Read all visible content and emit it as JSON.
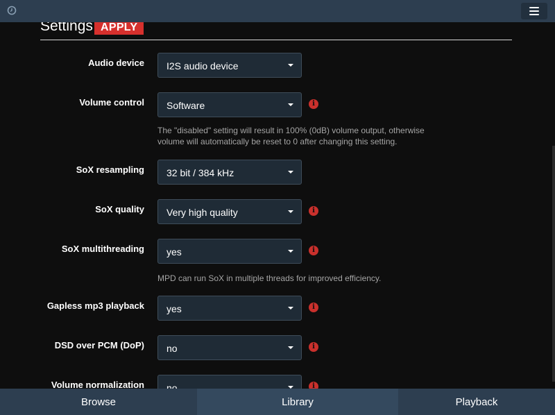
{
  "app": {
    "icons": {
      "status": "clock-icon",
      "menu": "hamburger-menu-icon",
      "info": "info-circle-icon"
    },
    "colors": {
      "bar": "#2d3e50",
      "apply": "#d6302d",
      "info": "#c9302c",
      "field": "#1f2b36"
    }
  },
  "header": {
    "title": "Settings",
    "apply_label": "APPLY"
  },
  "settings": [
    {
      "label": "Audio device",
      "value": "I2S audio device",
      "help": ""
    },
    {
      "label": "Volume control",
      "value": "Software",
      "help": "The \"disabled\" setting will result in 100% (0dB) volume output, otherwise volume will automatically be reset to 0 after changing this setting."
    },
    {
      "label": "SoX resampling",
      "value": "32 bit / 384 kHz",
      "help": ""
    },
    {
      "label": "SoX quality",
      "value": "Very high quality",
      "help": ""
    },
    {
      "label": "SoX multithreading",
      "value": "yes",
      "help": "MPD can run SoX in multiple threads for improved efficiency."
    },
    {
      "label": "Gapless mp3 playback",
      "value": "yes",
      "help": ""
    },
    {
      "label": "DSD over PCM (DoP)",
      "value": "no",
      "help": ""
    },
    {
      "label": "Volume normalization",
      "value": "no",
      "help": ""
    }
  ],
  "footer": {
    "tabs": [
      "Browse",
      "Library",
      "Playback"
    ]
  }
}
